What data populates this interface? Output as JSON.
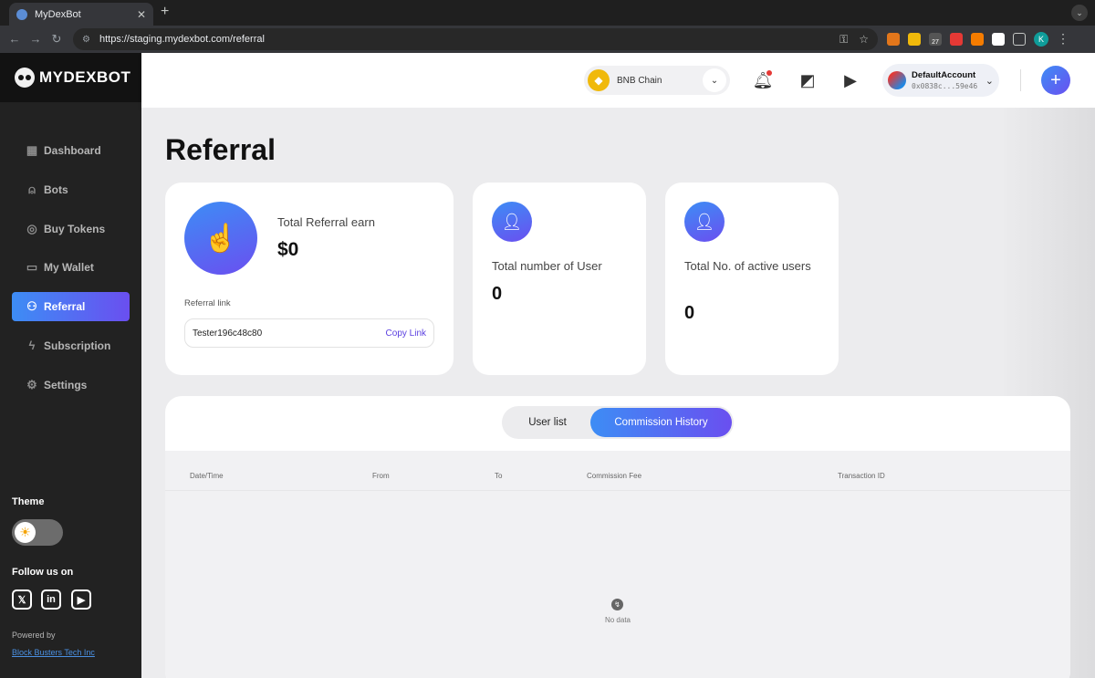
{
  "browser": {
    "tab_title": "MyDexBot",
    "tab_close": "✕",
    "new_tab": "+",
    "url": "https://staging.mydexbot.com/referral",
    "extension_badge": "27",
    "profile_initial": "K"
  },
  "sidebar": {
    "logo": "MYDEXBOT",
    "nav": [
      {
        "label": "Dashboard",
        "icon": "grid-icon"
      },
      {
        "label": "Bots",
        "icon": "bot-icon"
      },
      {
        "label": "Buy Tokens",
        "icon": "token-icon"
      },
      {
        "label": "My Wallet",
        "icon": "wallet-icon"
      },
      {
        "label": "Referral",
        "icon": "users-icon",
        "active": true
      },
      {
        "label": "Subscription",
        "icon": "bolt-icon"
      },
      {
        "label": "Settings",
        "icon": "gear-icon"
      }
    ],
    "theme_label": "Theme",
    "follow_label": "Follow us on",
    "socials": [
      "x-icon",
      "linkedin-icon",
      "youtube-icon"
    ],
    "powered_by": "Powered by",
    "company": "Block Busters Tech Inc"
  },
  "header": {
    "chain": "BNB Chain",
    "account_name": "DefaultAccount",
    "account_address": "0x0838c...59e46"
  },
  "page": {
    "title": "Referral",
    "earn_label": "Total Referral earn",
    "earn_value": "$0",
    "referral_link_label": "Referral link",
    "referral_code": "Tester196c48c80",
    "copy_label": "Copy Link",
    "users_label": "Total number of User",
    "users_value": "0",
    "active_label": "Total No. of active users",
    "active_value": "0"
  },
  "table": {
    "tabs": [
      "User list",
      "Commission History"
    ],
    "active_tab": "Commission History",
    "columns": [
      "Date/Time",
      "From",
      "To",
      "Commission Fee",
      "Transaction ID"
    ],
    "empty_text": "No data"
  },
  "colors": {
    "accent_start": "#3d8df5",
    "accent_end": "#6a4ff0",
    "sidebar_bg": "#222222",
    "bnb": "#f0b90b"
  }
}
